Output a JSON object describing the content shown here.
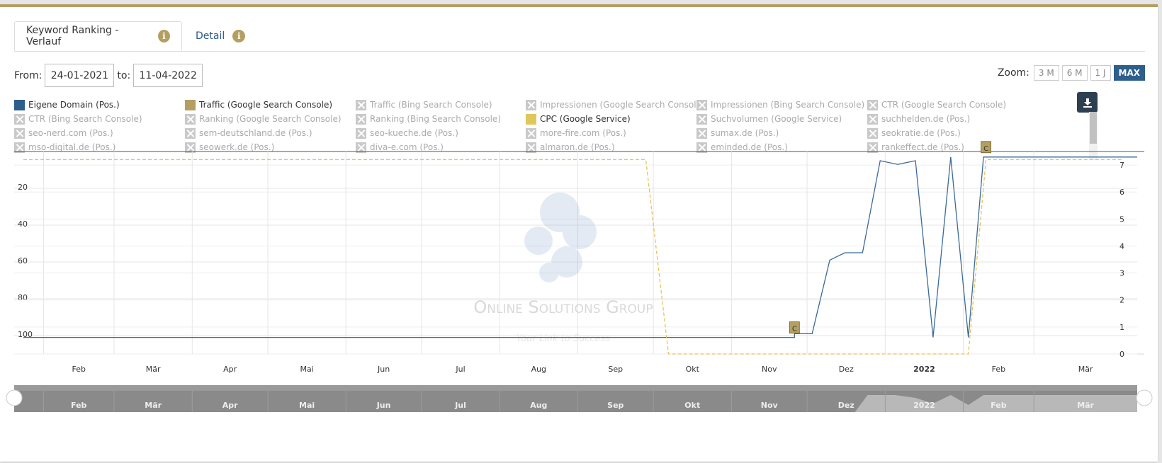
{
  "tabs": [
    {
      "label": "Keyword Ranking - Verlauf"
    },
    {
      "label": "Detail"
    }
  ],
  "info_icon": "i",
  "date_range": {
    "from_label": "From:",
    "from": "24-01-2021",
    "to_label": "to:",
    "to": "11-04-2022"
  },
  "zoom": {
    "label": "Zoom:",
    "options": [
      "3 M",
      "6 M",
      "1 J",
      "MAX"
    ],
    "active": "MAX"
  },
  "legend": [
    {
      "label": "Eigene Domain (Pos.)",
      "enabled": true,
      "color": "#2d5e8c"
    },
    {
      "label": "Traffic (Google Search Console)",
      "enabled": true,
      "color": "#b49f63"
    },
    {
      "label": "Traffic (Bing Search Console)",
      "enabled": false
    },
    {
      "label": "Impressionen (Google Search Console)",
      "enabled": false
    },
    {
      "label": "Impressionen (Bing Search Console)",
      "enabled": false
    },
    {
      "label": "CTR (Google Search Console)",
      "enabled": false
    },
    {
      "label": "CTR (Bing Search Console)",
      "enabled": false
    },
    {
      "label": "Ranking (Google Search Console)",
      "enabled": false
    },
    {
      "label": "Ranking (Bing Search Console)",
      "enabled": false
    },
    {
      "label": "CPC (Google Service)",
      "enabled": true,
      "color": "#e0c75c"
    },
    {
      "label": "Suchvolumen (Google Service)",
      "enabled": false
    },
    {
      "label": "suchhelden.de (Pos.)",
      "enabled": false
    },
    {
      "label": "seo-nerd.com (Pos.)",
      "enabled": false
    },
    {
      "label": "sem-deutschland.de (Pos.)",
      "enabled": false
    },
    {
      "label": "seo-kueche.de (Pos.)",
      "enabled": false
    },
    {
      "label": "more-fire.com (Pos.)",
      "enabled": false
    },
    {
      "label": "sumax.de (Pos.)",
      "enabled": false
    },
    {
      "label": "seokratie.de (Pos.)",
      "enabled": false
    },
    {
      "label": "mso-digital.de (Pos.)",
      "enabled": false
    },
    {
      "label": "seowerk.de (Pos.)",
      "enabled": false
    },
    {
      "label": "diva-e.com (Pos.)",
      "enabled": false
    },
    {
      "label": "almaron.de (Pos.)",
      "enabled": false
    },
    {
      "label": "eminded.de (Pos.)",
      "enabled": false
    },
    {
      "label": "rankeffect.de (Pos.)",
      "enabled": false
    }
  ],
  "watermark": {
    "line1": "Online Solutions Group",
    "line2": "Your Link to Success"
  },
  "chart_data": {
    "type": "line",
    "x_axis": {
      "type": "date",
      "min": "2021-01-24",
      "max": "2022-04-11",
      "ticks": [
        {
          "date": "2021-02-01",
          "label": "Feb"
        },
        {
          "date": "2021-03-01",
          "label": "Mär"
        },
        {
          "date": "2021-04-01",
          "label": "Apr"
        },
        {
          "date": "2021-05-01",
          "label": "Mai"
        },
        {
          "date": "2021-06-01",
          "label": "Jun"
        },
        {
          "date": "2021-07-01",
          "label": "Jul"
        },
        {
          "date": "2021-08-01",
          "label": "Aug"
        },
        {
          "date": "2021-09-01",
          "label": "Sep"
        },
        {
          "date": "2021-10-01",
          "label": "Okt"
        },
        {
          "date": "2021-11-01",
          "label": "Nov"
        },
        {
          "date": "2021-12-01",
          "label": "Dez"
        },
        {
          "date": "2022-01-01",
          "label": "2022",
          "bold": true
        },
        {
          "date": "2022-02-01",
          "label": "Feb"
        },
        {
          "date": "2022-03-01",
          "label": "Mär"
        }
      ]
    },
    "y_left": {
      "reversed": true,
      "min": 0,
      "max": 110,
      "ticks": [
        20,
        40,
        60,
        80,
        100
      ]
    },
    "y_right": {
      "min": 0,
      "max": 7.5,
      "ticks": [
        0,
        1,
        2,
        3,
        4,
        5,
        6,
        7
      ]
    },
    "grid": true,
    "series": [
      {
        "name": "Eigene Domain (Pos.)",
        "axis": "left",
        "color": "#3a6a99",
        "dash": false,
        "points": [
          [
            "2021-01-24",
            101
          ],
          [
            "2021-11-26",
            101
          ],
          [
            "2021-11-26",
            99
          ],
          [
            "2021-12-03",
            99
          ],
          [
            "2021-12-10",
            59
          ],
          [
            "2021-12-16",
            55
          ],
          [
            "2021-12-23",
            55
          ],
          [
            "2021-12-30",
            5
          ],
          [
            "2022-01-06",
            7
          ],
          [
            "2022-01-13",
            5
          ],
          [
            "2022-01-20",
            101
          ],
          [
            "2022-01-27",
            3
          ],
          [
            "2022-02-03",
            101
          ],
          [
            "2022-02-09",
            3
          ],
          [
            "2022-04-11",
            3
          ]
        ]
      },
      {
        "name": "CPC (Google Service)",
        "axis": "right",
        "color": "#e8c25a",
        "dash": true,
        "points": [
          [
            "2021-01-24",
            7.2
          ],
          [
            "2021-09-28",
            7.2
          ],
          [
            "2021-10-07",
            0
          ],
          [
            "2022-02-03",
            0
          ],
          [
            "2022-02-10",
            7.2
          ],
          [
            "2022-04-05",
            7.2
          ]
        ]
      }
    ],
    "flags": [
      {
        "date": "2021-11-26",
        "label": "C",
        "value": 101
      },
      {
        "date": "2022-02-10",
        "label": "C",
        "value": 3
      }
    ],
    "navigator": {
      "ticks": [
        "Feb",
        "Mär",
        "Apr",
        "Mai",
        "Jun",
        "Jul",
        "Aug",
        "Sep",
        "Okt",
        "Nov",
        "Dez",
        "2022",
        "Feb",
        "Mär"
      ]
    }
  }
}
